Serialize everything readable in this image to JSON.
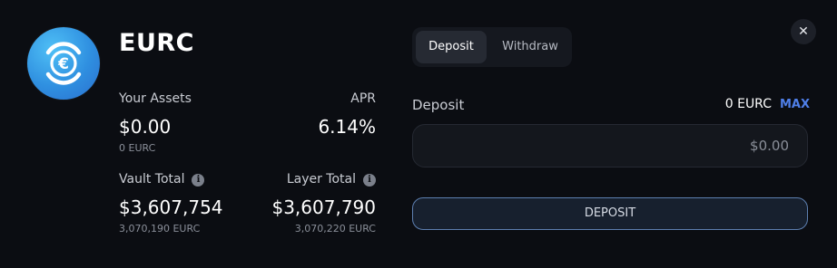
{
  "token": {
    "name": "EURC",
    "logo_icon": "euro-coin-icon",
    "logo_color": "#2f8fe0"
  },
  "stats": {
    "your_assets": {
      "label": "Your Assets",
      "value": "$0.00",
      "sub": "0 EURC"
    },
    "apr": {
      "label": "APR",
      "value": "6.14%"
    },
    "vault_total": {
      "label": "Vault Total",
      "value": "$3,607,754",
      "sub": "3,070,190 EURC",
      "icon": "info-icon"
    },
    "layer_total": {
      "label": "Layer Total",
      "value": "$3,607,790",
      "sub": "3,070,220 EURC",
      "icon": "info-icon"
    }
  },
  "tabs": [
    {
      "label": "Deposit",
      "active": true
    },
    {
      "label": "Withdraw",
      "active": false
    }
  ],
  "close": {
    "icon": "close-icon",
    "glyph": "✕"
  },
  "form": {
    "label": "Deposit",
    "balance": "0 EURC",
    "max_label": "MAX",
    "amount_placeholder": "$0.00",
    "submit_label": "DEPOSIT"
  },
  "colors": {
    "background": "#0b0d12",
    "accent": "#4f7fe8"
  }
}
